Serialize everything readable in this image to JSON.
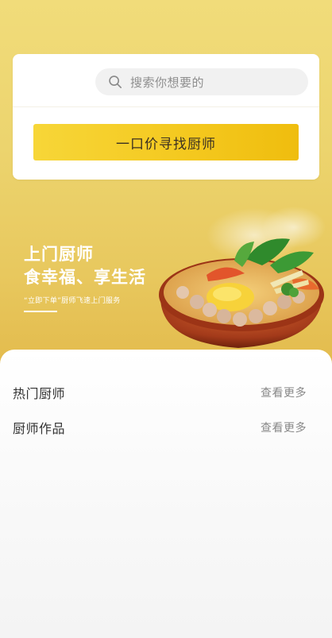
{
  "search": {
    "placeholder": "搜索你想要的"
  },
  "cta": {
    "label": "一口价寻找厨师"
  },
  "banner": {
    "title_line1": "上门厨师",
    "title_line2": "食幸福、享生活",
    "subtitle": "“立即下单”厨师飞速上门服务"
  },
  "sections": [
    {
      "title": "热门厨师",
      "more_label": "查看更多"
    },
    {
      "title": "厨师作品",
      "more_label": "查看更多"
    }
  ],
  "colors": {
    "accent": "#f4c81e",
    "hero_bg": "#ecd46e"
  },
  "icons": {
    "search": "search-icon"
  }
}
